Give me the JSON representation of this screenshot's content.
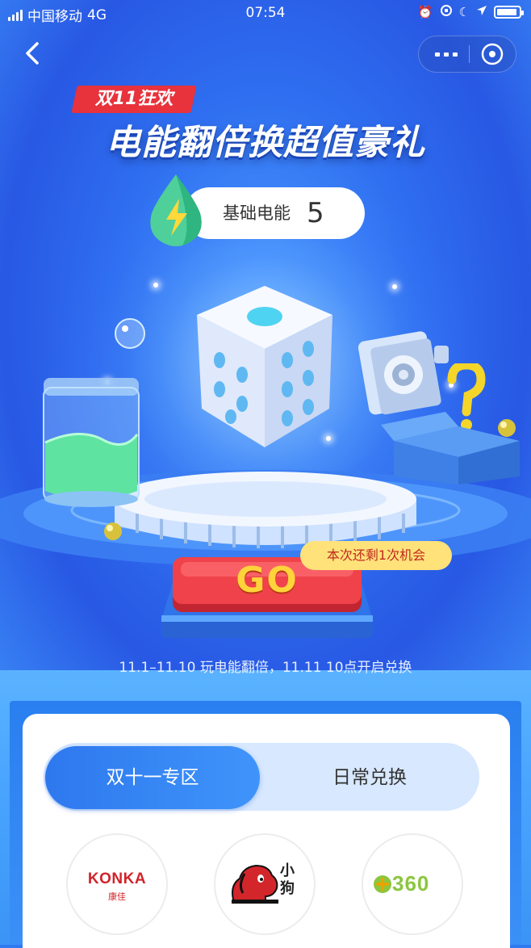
{
  "status_bar": {
    "carrier": "中国移动",
    "network": "4G",
    "time": "07:54",
    "icons": [
      "alarm-icon",
      "rotation-lock-icon",
      "moon-icon",
      "location-icon",
      "battery-icon"
    ]
  },
  "nav": {
    "back_icon": "chevron-left-icon",
    "more_icon": "more-icon",
    "close_icon": "close-miniprogram-icon"
  },
  "banner": {
    "event_badge": "双11狂欢",
    "headline": "电能翻倍换超值豪礼",
    "energy_label": "基础电能",
    "energy_value": "5"
  },
  "game": {
    "go_label": "GO",
    "chance_text": "本次还剩1次机会",
    "period_text": "11.1–11.10 玩电能翻倍，11.11 10点开启兑换"
  },
  "tabs": [
    {
      "label": "双十一专区",
      "active": true
    },
    {
      "label": "日常兑换",
      "active": false
    }
  ],
  "brands": [
    {
      "name": "KONKA",
      "sub": "康佳"
    },
    {
      "name": "小狗",
      "sub": ""
    },
    {
      "name": "360",
      "sub": ""
    }
  ],
  "colors": {
    "primary_blue": "#2f78ee",
    "badge_red": "#e8323c",
    "go_yellow": "#ffd33a",
    "tag_yellow": "#ffe27a"
  }
}
